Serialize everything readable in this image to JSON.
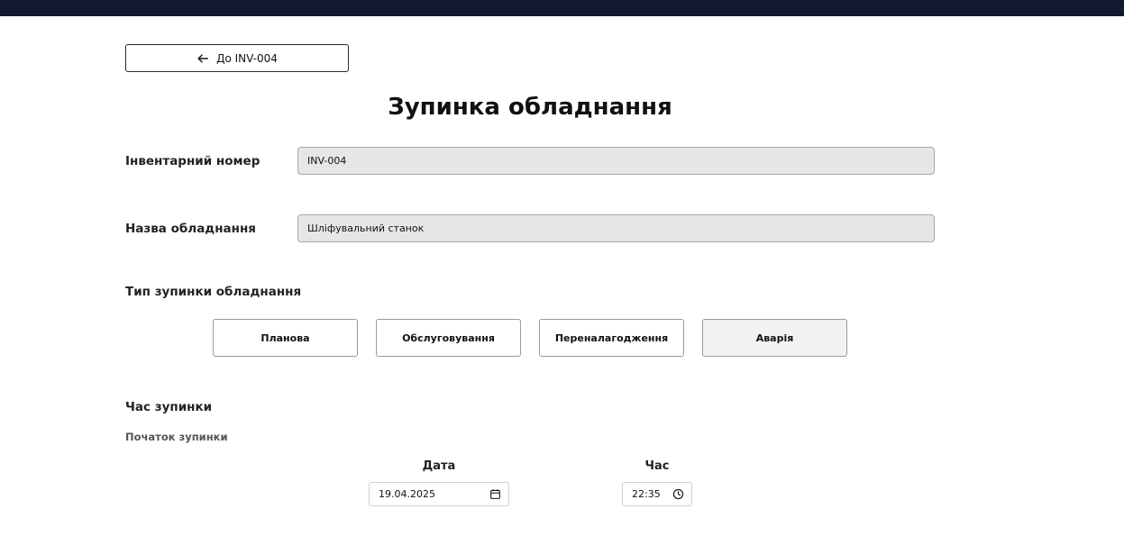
{
  "header": {
    "back_label": "До INV-004"
  },
  "page": {
    "title": "Зупинка обладнання"
  },
  "fields": {
    "inventory": {
      "label": "Інвентарний номер",
      "value": "INV-004"
    },
    "equipment_name": {
      "label": "Назва обладнання",
      "value": "Шліфувальний станок"
    }
  },
  "stop_type": {
    "label": "Тип зупинки обладнання",
    "options": [
      "Планова",
      "Обслуговування",
      "Переналагодження",
      "Аварія"
    ],
    "selected": "Аварія"
  },
  "stop_time": {
    "label": "Час зупинки",
    "start_label": "Початок зупинки",
    "date_label": "Дата",
    "date_value": "19.04.2025",
    "time_label": "Час",
    "time_value": "22:35"
  },
  "icons": [
    "arrow-left-icon",
    "calendar-icon",
    "clock-icon"
  ],
  "colors": {
    "topbar": "#111a2e",
    "readonly_bg": "#e6e6e6"
  }
}
